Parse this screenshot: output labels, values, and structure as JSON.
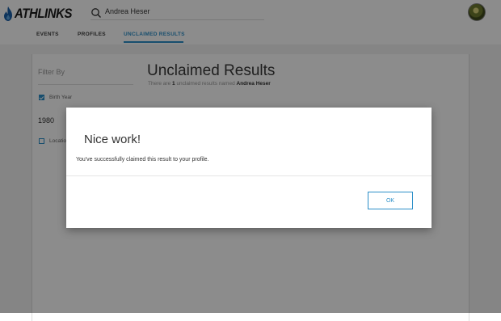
{
  "header": {
    "logo_text": "ATHLINKS",
    "search_value": "Andrea Heser"
  },
  "tabs": [
    {
      "label": "EVENTS",
      "active": false
    },
    {
      "label": "PROFILES",
      "active": false
    },
    {
      "label": "UNCLAIMED RESULTS",
      "active": true
    }
  ],
  "filter": {
    "title": "Filter By",
    "birth_year_label": "Birth Year",
    "birth_year_checked": true,
    "birth_year_value": "1980",
    "location_label": "Location",
    "location_checked": false
  },
  "results": {
    "title": "Unclaimed Results",
    "sub_prefix": "There are",
    "count": "1",
    "sub_middle": "unclaimed results named",
    "name": "Andrea Heser"
  },
  "modal": {
    "title": "Nice work!",
    "message": "You've successfully claimed this result to your profile.",
    "ok_label": "OK"
  },
  "colors": {
    "accent": "#2c8fc8",
    "logo_flame": "#1b5fa8"
  }
}
